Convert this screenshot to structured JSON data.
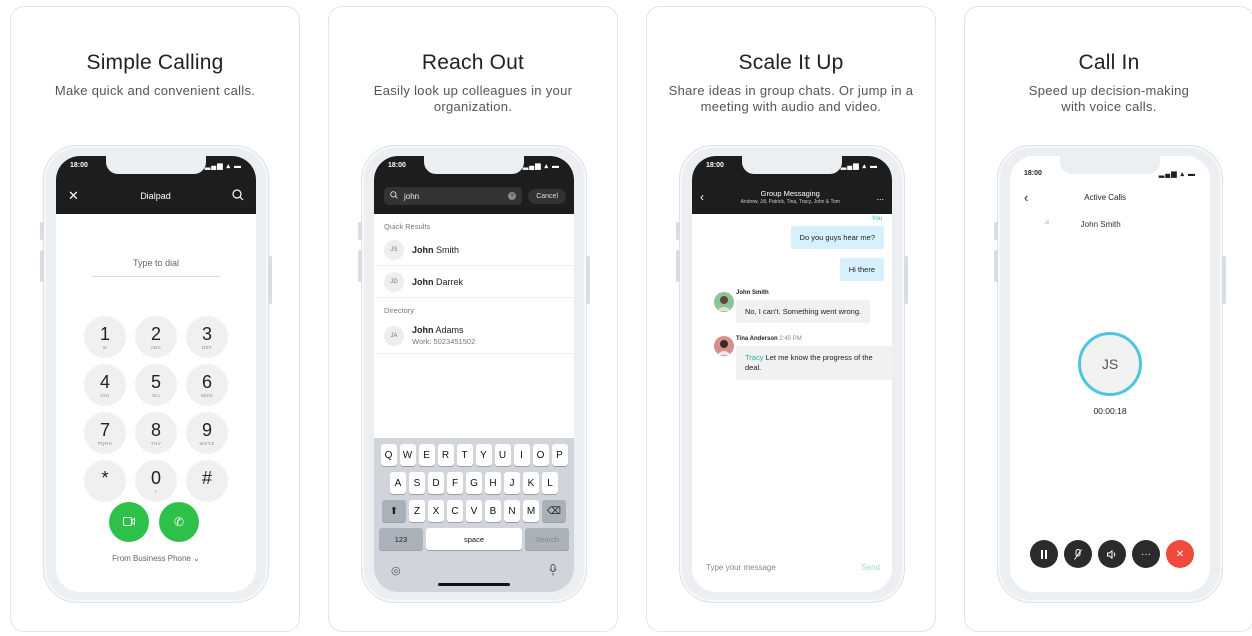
{
  "cards": [
    {
      "title": "Simple Calling",
      "subtitle": "Make quick and convenient calls."
    },
    {
      "title": "Reach Out",
      "subtitle": "Easily look up colleagues in your organization."
    },
    {
      "title": "Scale It Up",
      "subtitle": "Share ideas in group chats. Or jump in a meeting with audio and video."
    },
    {
      "title": "Call In",
      "subtitle": "Speed up decision-making with voice calls."
    }
  ],
  "status": {
    "time": "18:00",
    "icons": "▂▄▆ ▴ ▬"
  },
  "dialpad": {
    "title": "Dialpad",
    "placeholder": "Type to dial",
    "keys": [
      {
        "digit": "1",
        "letters": "✉"
      },
      {
        "digit": "2",
        "letters": "ABC"
      },
      {
        "digit": "3",
        "letters": "DEF"
      },
      {
        "digit": "4",
        "letters": "GHI"
      },
      {
        "digit": "5",
        "letters": "JKL"
      },
      {
        "digit": "6",
        "letters": "MNO"
      },
      {
        "digit": "7",
        "letters": "PQRS"
      },
      {
        "digit": "8",
        "letters": "TUV"
      },
      {
        "digit": "9",
        "letters": "WXYZ"
      },
      {
        "digit": "*",
        "letters": ""
      },
      {
        "digit": "0",
        "letters": "+"
      },
      {
        "digit": "#",
        "letters": ""
      }
    ],
    "from_label": "From Business Phone ⌄",
    "icons": {
      "close": "close-icon",
      "search": "search-icon",
      "video": "video-icon",
      "phone": "phone-icon"
    }
  },
  "search": {
    "query": "john",
    "cancel": "Cancel",
    "quick_results_label": "Quick Results",
    "quick_results": [
      {
        "initials": "JS",
        "first": "John",
        "last": "Smith"
      },
      {
        "initials": "JD",
        "first": "John",
        "last": "Darrek"
      }
    ],
    "directory_label": "Directory",
    "directory": [
      {
        "initials": "JA",
        "first": "John",
        "last": "Adams",
        "work": "Work: 5023451502"
      }
    ],
    "keyboard": {
      "row1": [
        "Q",
        "W",
        "E",
        "R",
        "T",
        "Y",
        "U",
        "I",
        "O",
        "P"
      ],
      "row2": [
        "A",
        "S",
        "D",
        "F",
        "G",
        "H",
        "J",
        "K",
        "L"
      ],
      "row3": [
        "Z",
        "X",
        "C",
        "V",
        "B",
        "N",
        "M"
      ],
      "shift": "⬆",
      "backspace": "⌫",
      "num": "123",
      "space": "space",
      "search": "Search",
      "globe": "◎",
      "mic": "♂"
    }
  },
  "messaging": {
    "title": "Group Messaging",
    "participants": "Andrew, Jill, Patrick, Tina, Tracy, John & Tom",
    "more": "...",
    "you_label": "You",
    "messages": [
      {
        "from": "me",
        "text": "Do you guys hear me?"
      },
      {
        "from": "me",
        "text": "Hi there"
      },
      {
        "from": "them",
        "sender": "John Smith",
        "time": "",
        "text": "No, I can't. Something went wrong."
      },
      {
        "from": "them",
        "sender": "Tina Anderson",
        "time": "2:45 PM",
        "mention": "Tracy",
        "text": "Let me know the progress of the deal."
      }
    ],
    "input_placeholder": "Type your message",
    "send": "Send"
  },
  "active_calls": {
    "title": "Active Calls",
    "caller": "John Smith",
    "signal": ".ıl",
    "initials": "JS",
    "timer": "00:00:18",
    "controls": [
      "pause-icon",
      "mute-icon",
      "speaker-icon",
      "more-icon",
      "end-call-icon"
    ]
  },
  "colors": {
    "accent_green": "#2ec14a",
    "accent_teal": "#27b4a4",
    "ring_blue": "#4cc5e0",
    "end_red": "#f04a3e",
    "header_dark": "#1d1d1d"
  }
}
